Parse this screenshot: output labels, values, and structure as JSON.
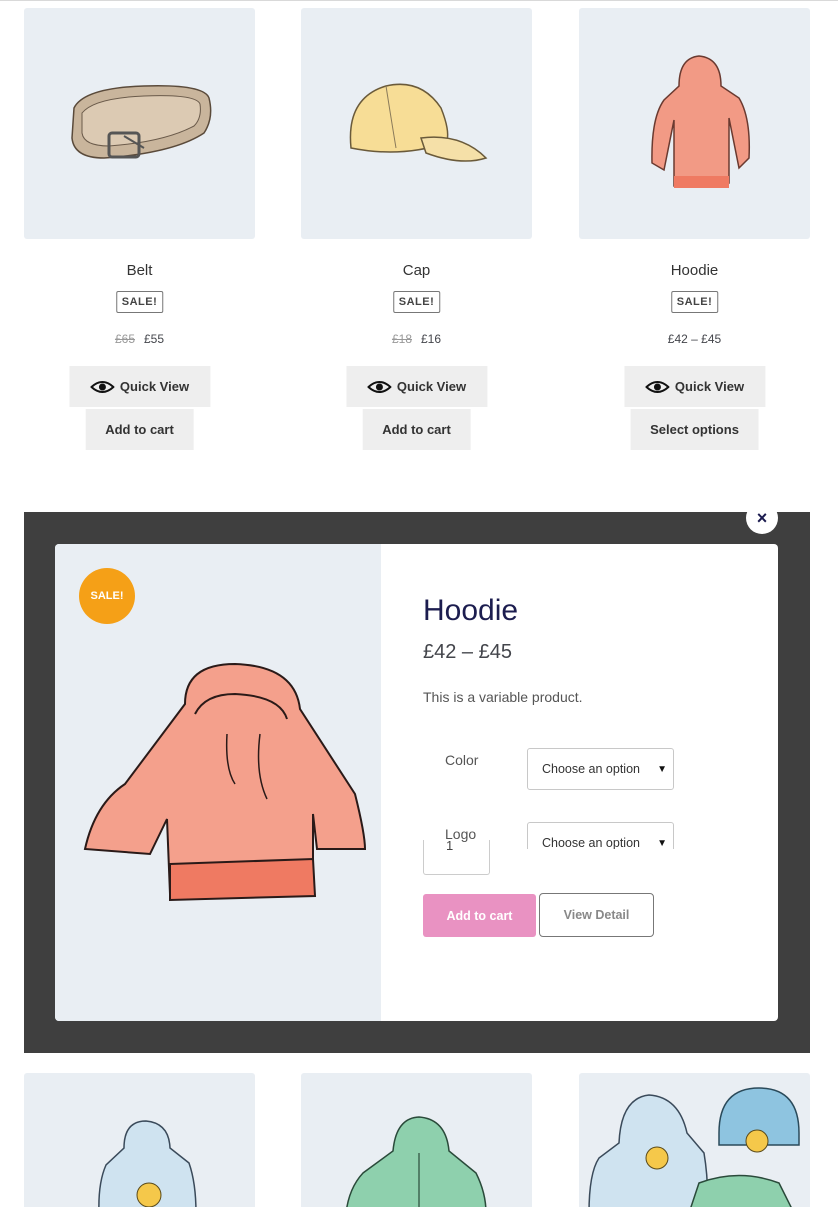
{
  "products": [
    {
      "title": "Belt",
      "badge": "SALE!",
      "old_price": "£65",
      "price": "£55",
      "quick_view": "Quick View",
      "action": "Add to cart"
    },
    {
      "title": "Cap",
      "badge": "SALE!",
      "old_price": "£18",
      "price": "£16",
      "quick_view": "Quick View",
      "action": "Add to cart"
    },
    {
      "title": "Hoodie",
      "badge": "SALE!",
      "old_price": "",
      "price": "£42 – £45",
      "quick_view": "Quick View",
      "action": "Select options"
    }
  ],
  "modal": {
    "close": "×",
    "sale_flash": "SALE!",
    "title": "Hoodie",
    "price": "£42 – £45",
    "description": "This is a variable product.",
    "variations": [
      {
        "label": "Color",
        "selected": "Choose an option"
      },
      {
        "label": "Logo",
        "selected": "Choose an option"
      }
    ],
    "quantity": "1",
    "add_to_cart": "Add to cart",
    "view_detail": "View Detail"
  },
  "colors": {
    "thumb_bg": "#e9eef3",
    "overlay": "#3f3f3f",
    "sale_flash": "#f5a017",
    "add_to_cart": "#e992c2",
    "title_navy": "#1c1d4f"
  },
  "icons": [
    "eye-icon",
    "close-icon",
    "chevron-down-icon"
  ]
}
